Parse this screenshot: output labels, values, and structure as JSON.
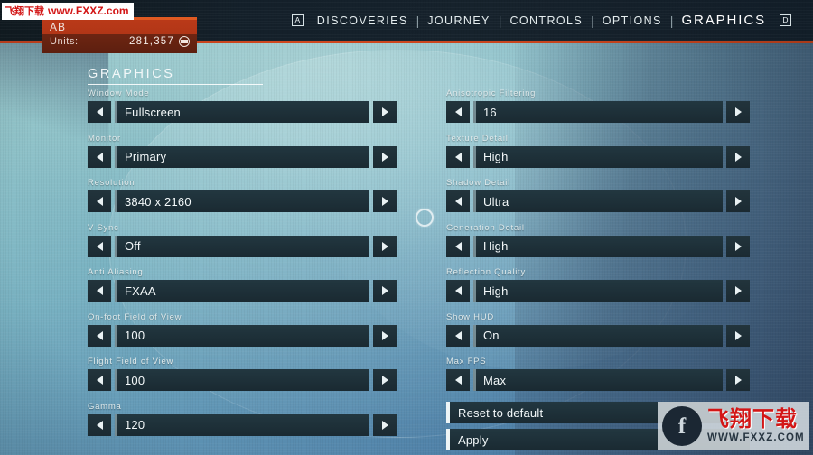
{
  "watermark_top": {
    "cn": "飞翔下载",
    "url": "www.FXXZ.com"
  },
  "watermark_bottom": {
    "logo_glyph": "f",
    "cn": "飞翔下载",
    "url": "WWW.FXXZ.COM"
  },
  "player": {
    "name": "AB",
    "units_label": "Units:",
    "units_value": "281,357",
    "coin_icon": "units-coin-icon"
  },
  "nav": {
    "left_key": "A",
    "right_key": "D",
    "separator": "|",
    "items": [
      {
        "label": "DISCOVERIES",
        "active": false
      },
      {
        "label": "JOURNEY",
        "active": false
      },
      {
        "label": "CONTROLS",
        "active": false
      },
      {
        "label": "OPTIONS",
        "active": false
      },
      {
        "label": "GRAPHICS",
        "active": true
      }
    ]
  },
  "section": {
    "title": "GRAPHICS"
  },
  "left_column": [
    {
      "label": "Window Mode",
      "value": "Fullscreen"
    },
    {
      "label": "Monitor",
      "value": "Primary"
    },
    {
      "label": "Resolution",
      "value": "3840 x 2160"
    },
    {
      "label": "V Sync",
      "value": "Off"
    },
    {
      "label": "Anti Aliasing",
      "value": "FXAA"
    },
    {
      "label": "On-foot Field of View",
      "value": "100"
    },
    {
      "label": "Flight Field of View",
      "value": "100"
    },
    {
      "label": "Gamma",
      "value": "120"
    }
  ],
  "right_column": [
    {
      "label": "Anisotropic Filtering",
      "value": "16"
    },
    {
      "label": "Texture Detail",
      "value": "High"
    },
    {
      "label": "Shadow Detail",
      "value": "Ultra"
    },
    {
      "label": "Generation Detail",
      "value": "High"
    },
    {
      "label": "Reflection Quality",
      "value": "High"
    },
    {
      "label": "Show HUD",
      "value": "On"
    },
    {
      "label": "Max FPS",
      "value": "Max"
    }
  ],
  "actions": [
    {
      "label": "Reset to default"
    },
    {
      "label": "Apply"
    }
  ],
  "colors": {
    "accent_red": "#c8441d",
    "panel_dark": "#1e2f38",
    "text_light": "#f4f9fa",
    "bg_teal": "#8fc2c8",
    "bg_slate": "#44709c"
  }
}
